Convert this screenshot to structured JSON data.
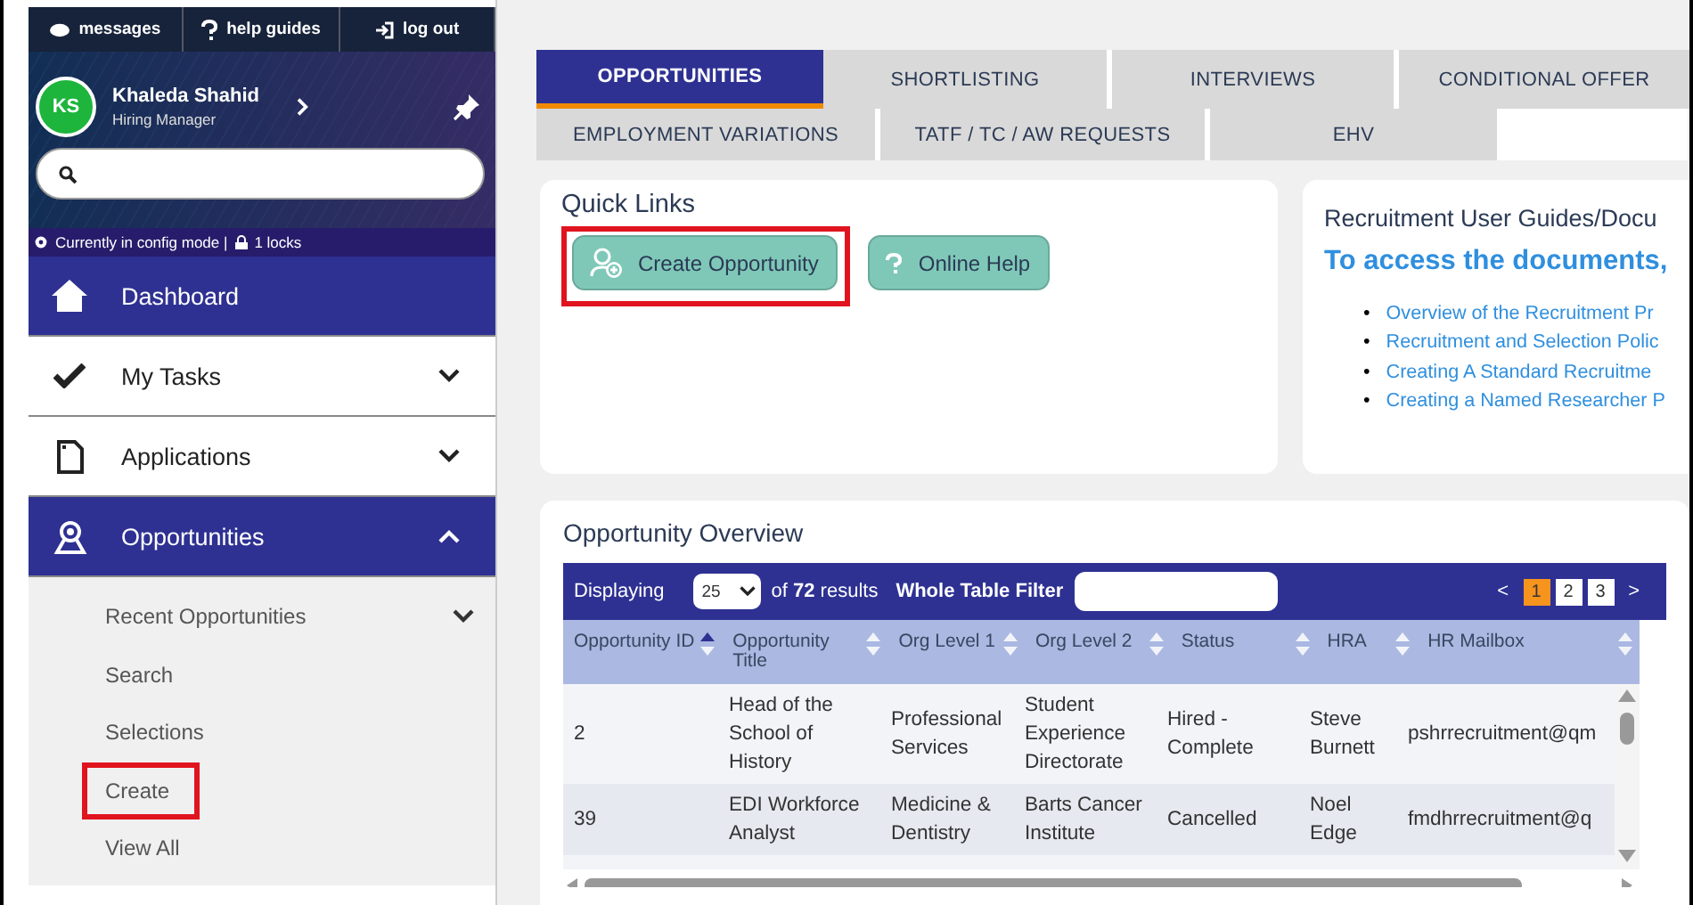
{
  "top_links": [
    {
      "label": "messages"
    },
    {
      "label": "help guides"
    },
    {
      "label": "log out"
    }
  ],
  "user": {
    "initials": "KS",
    "name": "Khaleda Shahid",
    "role": "Hiring Manager"
  },
  "config_bar": {
    "mode": "Currently in config mode |",
    "locks": "1 locks"
  },
  "nav": [
    {
      "label": "Dashboard",
      "kind": "link",
      "highlighted": true
    },
    {
      "label": "My Tasks",
      "kind": "group",
      "highlighted": false,
      "expanded": false
    },
    {
      "label": "Applications",
      "kind": "group",
      "highlighted": false,
      "expanded": false
    },
    {
      "label": "Opportunities",
      "kind": "group",
      "highlighted": true,
      "expanded": true,
      "children": [
        {
          "label": "Recent Opportunities",
          "kind": "group",
          "expanded": false,
          "marked": false
        },
        {
          "label": "Search",
          "kind": "link",
          "marked": false
        },
        {
          "label": "Selections",
          "kind": "link",
          "marked": false
        },
        {
          "label": "Create",
          "kind": "link",
          "marked": true
        },
        {
          "label": "View All",
          "kind": "link",
          "marked": false
        }
      ]
    }
  ],
  "tab_rows": [
    {
      "tabs": [
        {
          "label": "OPPORTUNITIES",
          "selected": true
        },
        {
          "label": "SHORTLISTING",
          "selected": false
        },
        {
          "label": "INTERVIEWS",
          "selected": false
        },
        {
          "label": "CONDITIONAL OFFER",
          "selected": false
        }
      ]
    },
    {
      "tabs": [
        {
          "label": "EMPLOYMENT VARIATIONS",
          "selected": false
        },
        {
          "label": "TATF / TC / AW REQUESTS",
          "selected": false
        },
        {
          "label": "EHV",
          "selected": false
        }
      ]
    }
  ],
  "quick_links": {
    "title": "Quick Links",
    "buttons": [
      {
        "label": "Create Opportunity",
        "marked": true
      },
      {
        "label": "Online Help",
        "marked": false
      }
    ]
  },
  "guides": {
    "title": "Recruitment User Guides/Docu",
    "subtitle": "To access the documents,",
    "links": [
      {
        "bullet": "•",
        "label": "Overview of the Recruitment Pr"
      },
      {
        "bullet": "•",
        "label": "Recruitment and Selection Polic"
      },
      {
        "bullet": "•",
        "label": "Creating A Standard Recruitme"
      },
      {
        "bullet": "•",
        "label": "Creating a Named Researcher P"
      }
    ]
  },
  "overview": {
    "title": "Opportunity Overview",
    "toolbar": {
      "displaying": "Displaying",
      "page_size": "25",
      "results": "of **72** results",
      "filter_label": "Whole Table Filter",
      "prev": "<",
      "next": ">",
      "pages": [
        {
          "label": "1",
          "selected": true
        },
        {
          "label": "2",
          "selected": false
        },
        {
          "label": "3",
          "selected": false
        }
      ]
    },
    "columns": [
      {
        "label": "Opportunity ID",
        "sorted": true
      },
      {
        "label": "Opportunity Title",
        "sorted": false
      },
      {
        "label": "Org Level 1",
        "sorted": false
      },
      {
        "label": "Org Level 2",
        "sorted": false
      },
      {
        "label": "Status",
        "sorted": false
      },
      {
        "label": "HRA",
        "sorted": false
      },
      {
        "label": "HR Mailbox",
        "sorted": false
      }
    ],
    "rows": [
      [
        "2",
        "Head of the School of History",
        "Professional Services",
        "Student Experience Directorate",
        "Hired - Complete",
        "Steve Burnett",
        "pshrrecruitment@qm"
      ],
      [
        "39",
        "EDI Workforce Analyst",
        "Medicine & Dentistry",
        "Barts Cancer Institute",
        "Cancelled",
        "Noel Edge",
        "fmdhrrecruitment@q"
      ]
    ]
  }
}
